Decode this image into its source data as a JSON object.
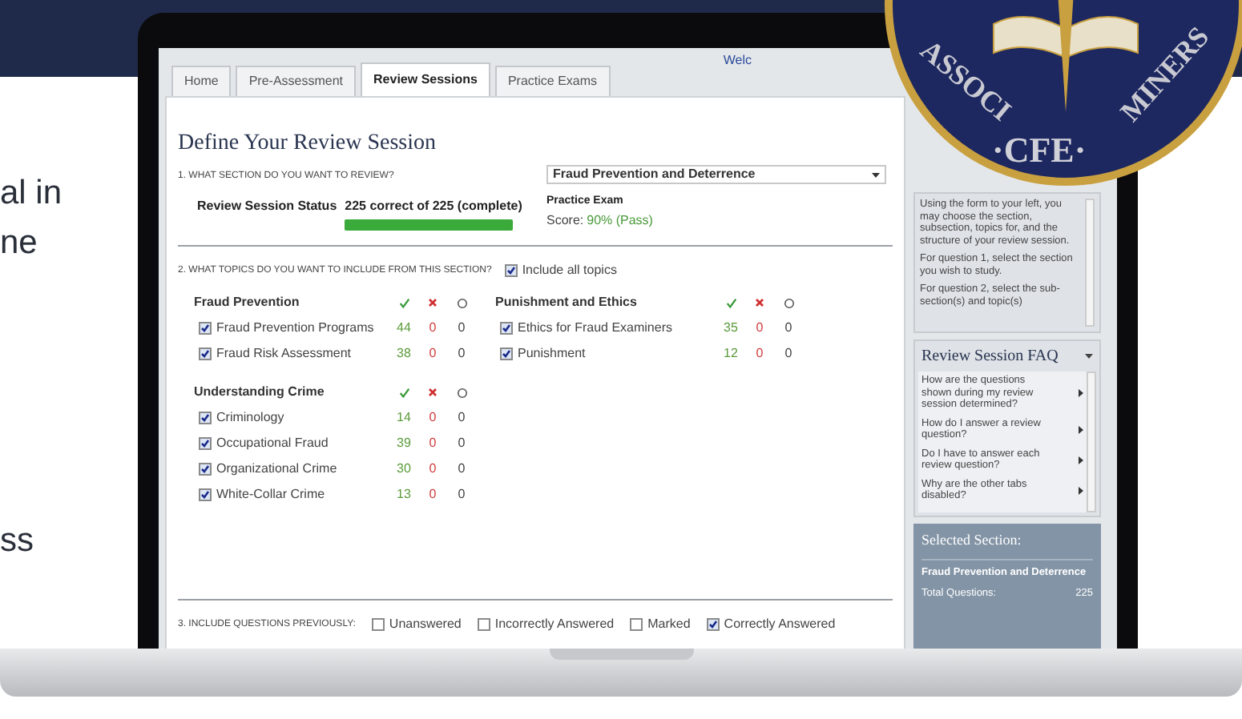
{
  "background_text": [
    "al in",
    "ne",
    "ss"
  ],
  "seal": {
    "top_text": "ASSOCI",
    "center_text": "·CFE·",
    "right_text": "MINERS"
  },
  "header": {
    "welcome": "Welc"
  },
  "tabs": [
    {
      "label": "Home",
      "selected": false
    },
    {
      "label": "Pre-Assessment",
      "selected": false
    },
    {
      "label": "Review Sessions",
      "selected": true
    },
    {
      "label": "Practice Exams",
      "selected": false
    }
  ],
  "title": "Define Your Review Session",
  "question_1": {
    "label": "1. WHAT SECTION DO YOU WANT TO REVIEW?",
    "section_select": "Fraud Prevention and Deterrence",
    "status_label": "Review Session Status",
    "status_value": "225 correct of 225 (complete)",
    "level": 1,
    "practice_exam_label": "Practice Exam",
    "score_label": "Score:",
    "score_value": "90% (Pass)"
  },
  "question_2": {
    "label": "2. WHAT TOPICS DO YOU WANT TO INCLUDE FROM THIS SECTION?",
    "include_all": {
      "label": "Include all topics",
      "checked": true
    },
    "columns": [
      [
        {
          "title": "Fraud Prevention",
          "topics": [
            {
              "label": "Fraud Prevention Programs",
              "checked": true,
              "correct": "44",
              "incorrect": "0",
              "unanswered": "0"
            },
            {
              "label": "Fraud Risk Assessment",
              "checked": true,
              "correct": "38",
              "incorrect": "0",
              "unanswered": "0"
            }
          ]
        },
        {
          "title": "Understanding Crime",
          "topics": [
            {
              "label": "Criminology",
              "checked": true,
              "correct": "14",
              "incorrect": "0",
              "unanswered": "0"
            },
            {
              "label": "Occupational Fraud",
              "checked": true,
              "correct": "39",
              "incorrect": "0",
              "unanswered": "0"
            },
            {
              "label": "Organizational Crime",
              "checked": true,
              "correct": "30",
              "incorrect": "0",
              "unanswered": "0"
            },
            {
              "label": "White-Collar Crime",
              "checked": true,
              "correct": "13",
              "incorrect": "0",
              "unanswered": "0"
            }
          ]
        }
      ],
      [
        {
          "title": "Punishment and Ethics",
          "topics": [
            {
              "label": "Ethics for Fraud Examiners",
              "checked": true,
              "correct": "35",
              "incorrect": "0",
              "unanswered": "0"
            },
            {
              "label": "Punishment",
              "checked": true,
              "correct": "12",
              "incorrect": "0",
              "unanswered": "0"
            }
          ]
        }
      ]
    ]
  },
  "question_3": {
    "label": "3. INCLUDE QUESTIONS PREVIOUSLY:",
    "options": [
      {
        "label": "Unanswered",
        "checked": false
      },
      {
        "label": "Incorrectly Answered",
        "checked": false
      },
      {
        "label": "Marked",
        "checked": false
      },
      {
        "label": "Correctly Answered",
        "checked": true
      }
    ]
  },
  "help": {
    "paragraphs": [
      "Using the form to your left, you may choose the section, subsection, topics for, and the structure of your review session.",
      "For question 1, select the section you wish to study.",
      "For question 2, select the sub-section(s) and topic(s)"
    ]
  },
  "faq": {
    "title": "Review Session FAQ",
    "items": [
      "How are the questions shown during my review session determined?",
      "How do I answer a review question?",
      "Do I have to answer each review question?",
      "Why are the other tabs disabled?"
    ]
  },
  "selected_section": {
    "title": "Selected Section:",
    "name": "Fraud Prevention and Deterrence",
    "total_label": "Total Questions:",
    "total_value": "225"
  }
}
